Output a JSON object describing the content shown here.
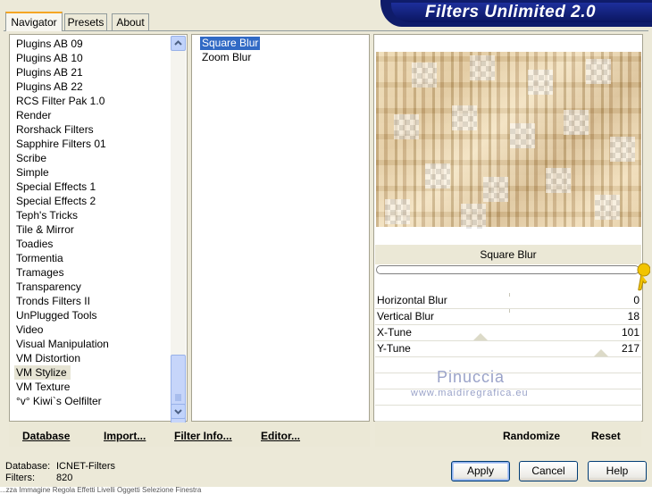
{
  "app_title": "Filters Unlimited 2.0",
  "tabs": [
    {
      "label": "Navigator",
      "active": true
    },
    {
      "label": "Presets",
      "active": false
    },
    {
      "label": "About",
      "active": false
    }
  ],
  "categories": [
    "Plugins AB 09",
    "Plugins AB 10",
    "Plugins AB 21",
    "Plugins AB 22",
    "RCS Filter Pak 1.0",
    "Render",
    "Rorshack Filters",
    "Sapphire Filters 01",
    "Scribe",
    "Simple",
    "Special Effects 1",
    "Special Effects 2",
    "Teph's Tricks",
    "Tile & Mirror",
    "Toadies",
    "Tormentia",
    "Tramages",
    "Transparency",
    "Tronds Filters II",
    "UnPlugged Tools",
    "Video",
    "Visual Manipulation",
    "VM Distortion",
    "VM Stylize",
    "VM Texture",
    "°v° Kiwi`s Oelfilter"
  ],
  "selected_category": "VM Stylize",
  "filters": [
    "Square Blur",
    "Zoom Blur"
  ],
  "selected_filter": "Square Blur",
  "filter_title": "Square Blur",
  "params": [
    {
      "label": "Horizontal Blur",
      "value": "0"
    },
    {
      "label": "Vertical Blur",
      "value": "18"
    },
    {
      "label": "X-Tune",
      "value": "101"
    },
    {
      "label": "Y-Tune",
      "value": "217"
    }
  ],
  "watermark": {
    "name": "Pinuccia",
    "url": "www.maidiregrafica.eu"
  },
  "bottom_left_buttons": [
    "Database",
    "Import...",
    "Filter Info...",
    "Editor..."
  ],
  "bottom_right_buttons": [
    "Randomize",
    "Reset"
  ],
  "info": {
    "database_label": "Database:",
    "database_value": "ICNET-Filters",
    "filters_label": "Filters:",
    "filters_value": "820"
  },
  "dialog_buttons": {
    "apply": "Apply",
    "cancel": "Cancel",
    "help": "Help"
  },
  "footer_text": "...zza    Immagine    Regola    Effetti    Livelli    Oggetti    Selezione    Finestra"
}
